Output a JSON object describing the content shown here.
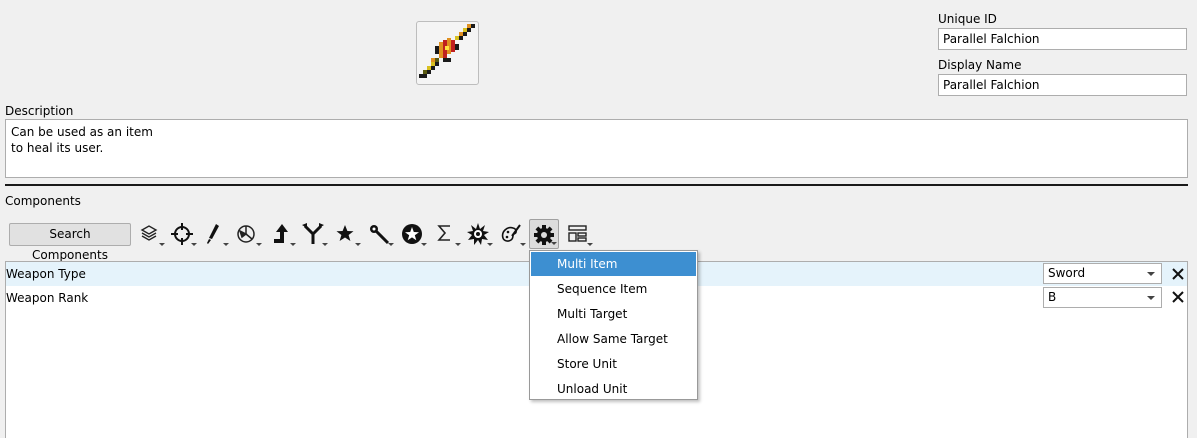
{
  "header": {
    "unique_id_label": "Unique ID",
    "unique_id_value": "Parallel Falchion",
    "display_name_label": "Display Name",
    "display_name_value": "Parallel Falchion",
    "item_icon": "sword-sprite-icon"
  },
  "description": {
    "label": "Description",
    "lines": [
      "Can be used as an item",
      "to heal its user."
    ]
  },
  "components": {
    "label": "Components",
    "search_button": "Search Components",
    "toolbar_icons": [
      "layers-icon",
      "crosshair-icon",
      "brush-icon",
      "pie-icon",
      "arrow-up-icon",
      "fork-icon",
      "star-icon",
      "wand-icon",
      "badge-icon",
      "sigma-icon",
      "burst-icon",
      "palette-icon",
      "gear-icon",
      "layout-icon"
    ],
    "rows": [
      {
        "name": "Weapon Type",
        "value": "Sword"
      },
      {
        "name": "Weapon Rank",
        "value": "B"
      }
    ]
  },
  "menu": {
    "items": [
      "Multi Item",
      "Sequence Item",
      "Multi Target",
      "Allow Same Target",
      "Store Unit",
      "Unload Unit"
    ],
    "highlighted": "Multi Item"
  },
  "colors": {
    "highlight": "#3d8fd1",
    "row_selected": "#e5f3fb"
  }
}
